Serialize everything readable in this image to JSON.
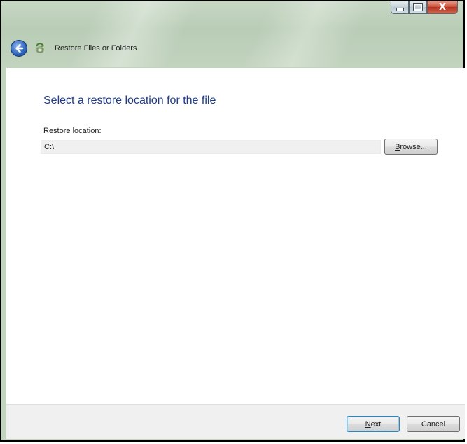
{
  "window": {
    "title": "Restore Files or Folders",
    "controls": {
      "minimize_icon": "minimize-icon",
      "maximize_icon": "maximize-icon",
      "close_label": "X"
    }
  },
  "nav": {
    "back_icon": "back-arrow-icon",
    "app_icon": "restore-files-icon",
    "title": "Restore Files or Folders"
  },
  "main": {
    "heading": "Select a restore location for the file",
    "location_label": "Restore location:",
    "location_value": "C:\\",
    "browse_label": "Browse..."
  },
  "footer": {
    "next_label": "Next",
    "cancel_label": "Cancel"
  },
  "colors": {
    "heading": "#1e3a8a",
    "frame": "#b9cdb6",
    "close_button": "#c8503a",
    "field_background": "#f0f0f0"
  }
}
